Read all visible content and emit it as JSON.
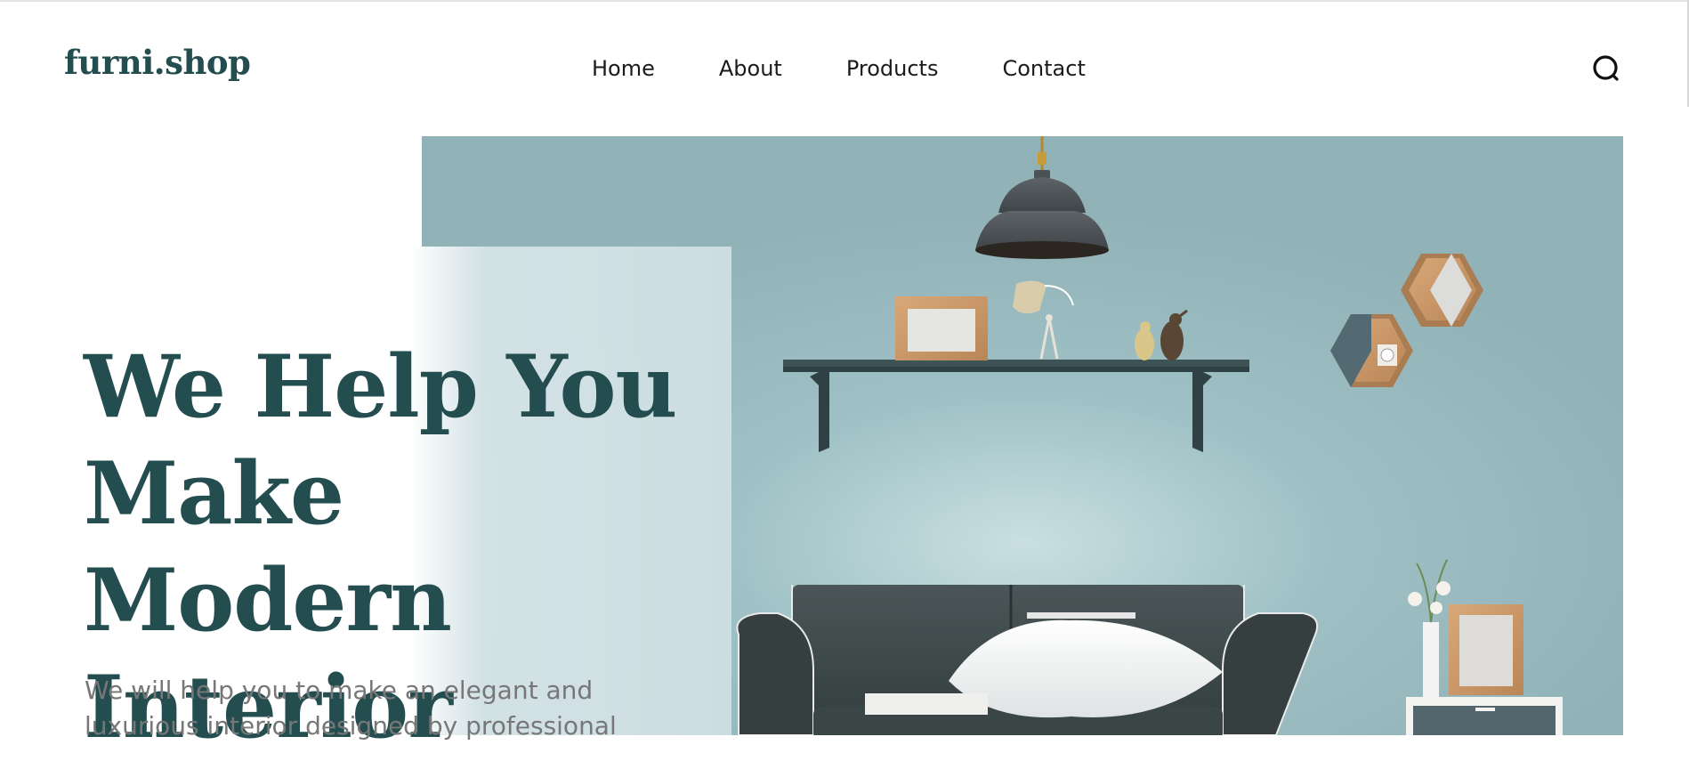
{
  "header": {
    "logo": "furni.shop",
    "nav": [
      {
        "label": "Home"
      },
      {
        "label": "About"
      },
      {
        "label": "Products"
      },
      {
        "label": "Contact"
      }
    ],
    "search_icon": "search-icon"
  },
  "hero": {
    "title_lines": [
      "We Help You",
      "Make Modern",
      "Interior"
    ],
    "subtitle_lines": [
      "We will help you to make an elegant and",
      "luxurious interior designed by professional"
    ],
    "image": "living room with sofa, shelf, pendant lamp and hexagon wall shelves"
  },
  "colors": {
    "brand": "#234d4f",
    "wall": "#94b6bb",
    "panel": "#ccdde1",
    "sofa": "#3d4a4b"
  }
}
